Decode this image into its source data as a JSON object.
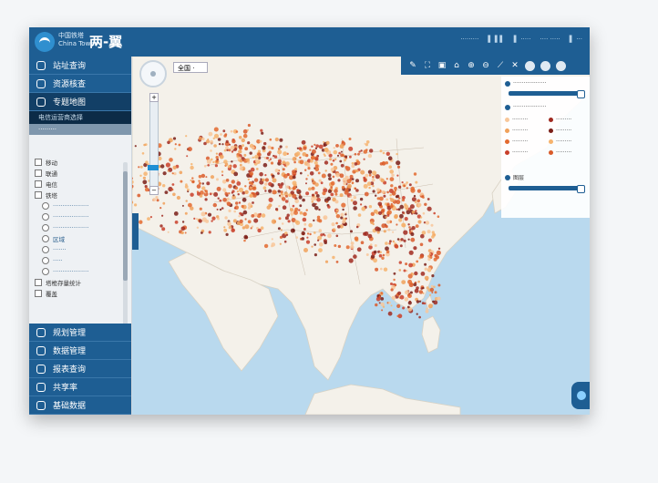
{
  "header": {
    "brand_line1": "中国铁塔",
    "brand_line2": "China Tower",
    "system_name": "两-翼",
    "top_items": [
      "·········",
      "▌ ▌▌",
      "▌ ·····",
      "···· ·····",
      "▌ ···"
    ]
  },
  "sidebar": {
    "top_nav": [
      {
        "label": "站址查询",
        "icon": "search-icon"
      },
      {
        "label": "资源核查",
        "icon": "refresh-icon"
      },
      {
        "label": "专题地图",
        "icon": "globe-icon",
        "active": true
      }
    ],
    "sub_header": "电信运营商选择",
    "sub_header2": "·········",
    "tree": [
      {
        "label": "移动",
        "level": 1
      },
      {
        "label": "联通",
        "level": 1
      },
      {
        "label": "电信",
        "level": 1
      },
      {
        "label": "铁塔",
        "level": 1
      },
      {
        "label": "···················",
        "level": 2
      },
      {
        "label": "···················",
        "level": 2
      },
      {
        "label": "···················",
        "level": 2
      },
      {
        "label": "区域",
        "level": 2
      },
      {
        "label": "·······",
        "level": 2
      },
      {
        "label": "·····",
        "level": 2
      },
      {
        "label": "···················",
        "level": 2
      },
      {
        "label": "塔桅存量统计",
        "level": 1
      },
      {
        "label": "覆盖",
        "level": 1
      }
    ],
    "bottom_nav": [
      {
        "label": "规划管理",
        "icon": "clipboard-icon"
      },
      {
        "label": "数据管理",
        "icon": "database-icon"
      },
      {
        "label": "报表查询",
        "icon": "report-icon"
      },
      {
        "label": "共享率",
        "icon": "share-icon"
      },
      {
        "label": "基础数据",
        "icon": "building-icon"
      }
    ]
  },
  "map": {
    "scope_select": "全国 ·",
    "legend": {
      "opacity_label": "···················",
      "type_label": "···················",
      "items": [
        "·········",
        "·········",
        "·········",
        "·········",
        "·········",
        "·········",
        "·········",
        "·········"
      ],
      "size_label": "图层",
      "dot_colors": [
        "#f8c79a",
        "#f0a15a",
        "#e36a2f",
        "#c93f2a",
        "#a02a20",
        "#7a1f18",
        "#f6b36d",
        "#d95b2a"
      ]
    },
    "toolbar_icons": [
      "pen-icon",
      "fullscreen-icon",
      "select-icon",
      "tag-icon",
      "zoom-in-icon",
      "zoom-out-icon",
      "measure-icon",
      "expand-icon",
      "globe-icon",
      "layers-icon",
      "print-icon"
    ]
  }
}
